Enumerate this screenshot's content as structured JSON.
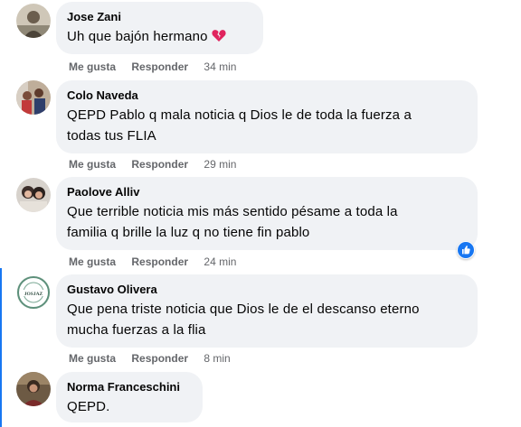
{
  "comments": [
    {
      "author": "Jose Zani",
      "lines": [
        "Uh que bajón hermano"
      ],
      "emoji": "broken-heart-icon",
      "like": "Me gusta",
      "reply": "Responder",
      "time": "34 min"
    },
    {
      "author": "Colo Naveda",
      "lines": [
        "QEPD Pablo q mala noticia q Dios le de toda la fuerza a",
        "todas tus FLIA"
      ],
      "like": "Me gusta",
      "reply": "Responder",
      "time": "29 min"
    },
    {
      "author": "Paolove Alliv",
      "lines": [
        "Que terrible noticia mis más sentido pésame a toda la",
        "familia q brille la luz q no tiene fin pablo"
      ],
      "reaction": "like-reaction-icon",
      "like": "Me gusta",
      "reply": "Responder",
      "time": "24 min"
    },
    {
      "author": "Gustavo Olivera",
      "lines": [
        "Que pena triste noticia que Dios le de el descanso eterno",
        "mucha fuerzas a la flia"
      ],
      "avatar_text": "JOSJAZ",
      "like": "Me gusta",
      "reply": "Responder",
      "time": "8 min"
    },
    {
      "author": "Norma Franceschini",
      "lines": [
        "QEPD."
      ]
    }
  ],
  "colors": {
    "bubble": "#f0f2f5",
    "meta_text": "#65676b",
    "thread_line": "#1877f2",
    "like_blue": "#1877f2",
    "broken_heart": "#e0245e"
  }
}
